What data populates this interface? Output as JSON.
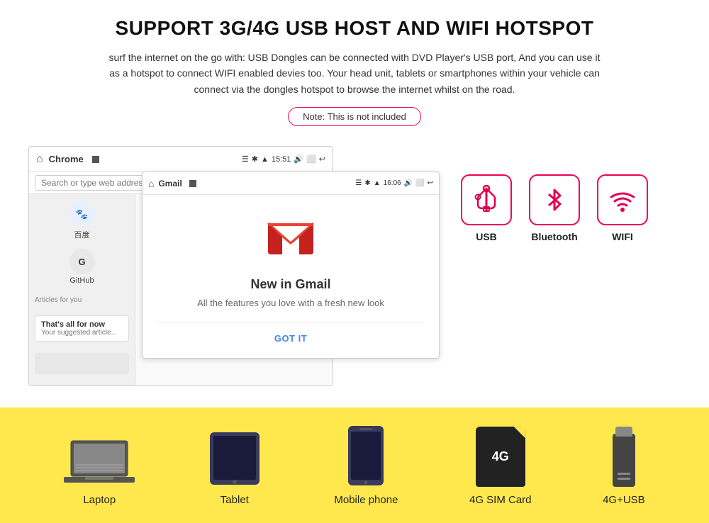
{
  "header": {
    "title": "SUPPORT 3G/4G USB HOST AND WIFI HOTSPOT",
    "description": "surf the internet on the go with: USB Dongles can be connected with DVD Player's USB port, And you can use it as a hotspot to connect WIFI enabled devies too. Your head unit, tablets or smartphones within your vehicle can connect via the dongles hotspot to browse the internet whilst on the road.",
    "note": "Note: This is not included"
  },
  "browser": {
    "tab_name": "Chrome",
    "time": "15:51",
    "address_placeholder": "Search or type web address",
    "left_icons": [
      {
        "name": "百度",
        "initial": "🐾"
      },
      {
        "name": "GitHub",
        "initial": "G"
      }
    ],
    "articles_label": "Articles for you",
    "thats_all_title": "That's all for now",
    "thats_all_sub": "Your suggested article..."
  },
  "gmail": {
    "app_name": "Gmail",
    "time": "16:06",
    "new_title": "New in Gmail",
    "new_sub": "All the features you love with a fresh new look",
    "got_it": "GOT IT"
  },
  "connectivity": {
    "icons": [
      {
        "id": "usb",
        "label": "USB"
      },
      {
        "id": "bluetooth",
        "label": "Bluetooth"
      },
      {
        "id": "wifi",
        "label": "WIFI"
      }
    ]
  },
  "devices": [
    {
      "id": "laptop",
      "label": "Laptop"
    },
    {
      "id": "tablet",
      "label": "Tablet"
    },
    {
      "id": "mobile",
      "label": "Mobile phone"
    },
    {
      "id": "sim",
      "label": "4G SIM Card",
      "text": "4G"
    },
    {
      "id": "usb",
      "label": "4G+USB"
    }
  ]
}
